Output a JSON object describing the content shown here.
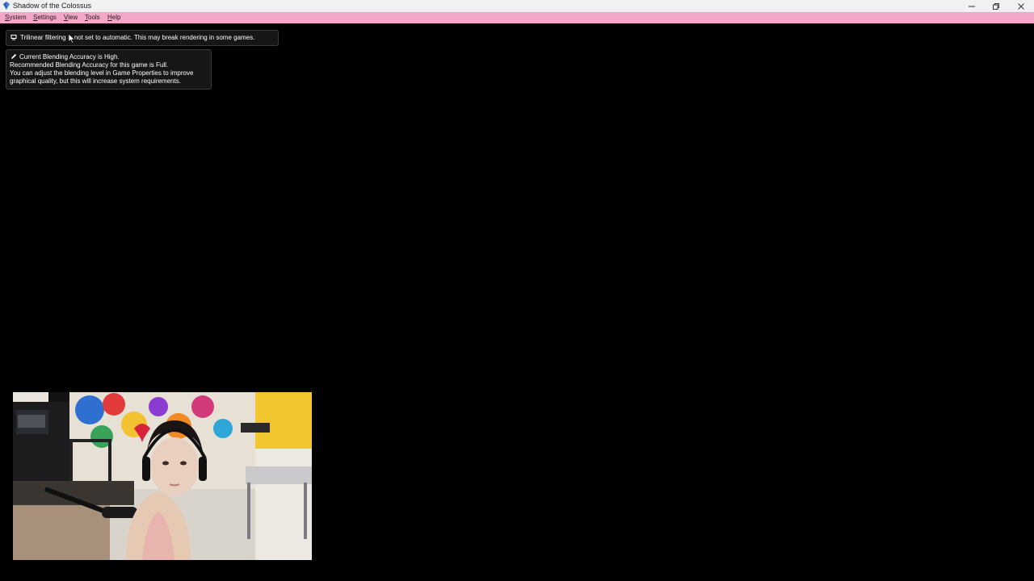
{
  "window": {
    "title": "Shadow of the Colossus",
    "app_icon": "pcsx2-logo-icon",
    "controls": {
      "minimize_icon": "minimize-icon",
      "maximize_icon": "restore-icon",
      "close_icon": "close-icon"
    }
  },
  "menubar": {
    "accent_color": "#f3a7c6",
    "items": [
      {
        "accel": "S",
        "rest": "ystem"
      },
      {
        "accel": "S",
        "rest": "ettings"
      },
      {
        "accel": "V",
        "rest": "iew"
      },
      {
        "accel": "T",
        "rest": "ools"
      },
      {
        "accel": "H",
        "rest": "elp"
      }
    ]
  },
  "osd": {
    "trilinear_message": "Trilinear filtering is not set to automatic. This may break rendering in some games.",
    "trilinear_icon": "display-icon",
    "blending_icon": "pencil-icon",
    "blending_lines": [
      "Current Blending Accuracy is High.",
      "Recommended Blending Accuracy for this game is Full.",
      "You can adjust the blending level in Game Properties to improve",
      "graphical quality, but this will increase system requirements."
    ]
  },
  "webcam": {
    "icon": "webcam-overlay"
  }
}
